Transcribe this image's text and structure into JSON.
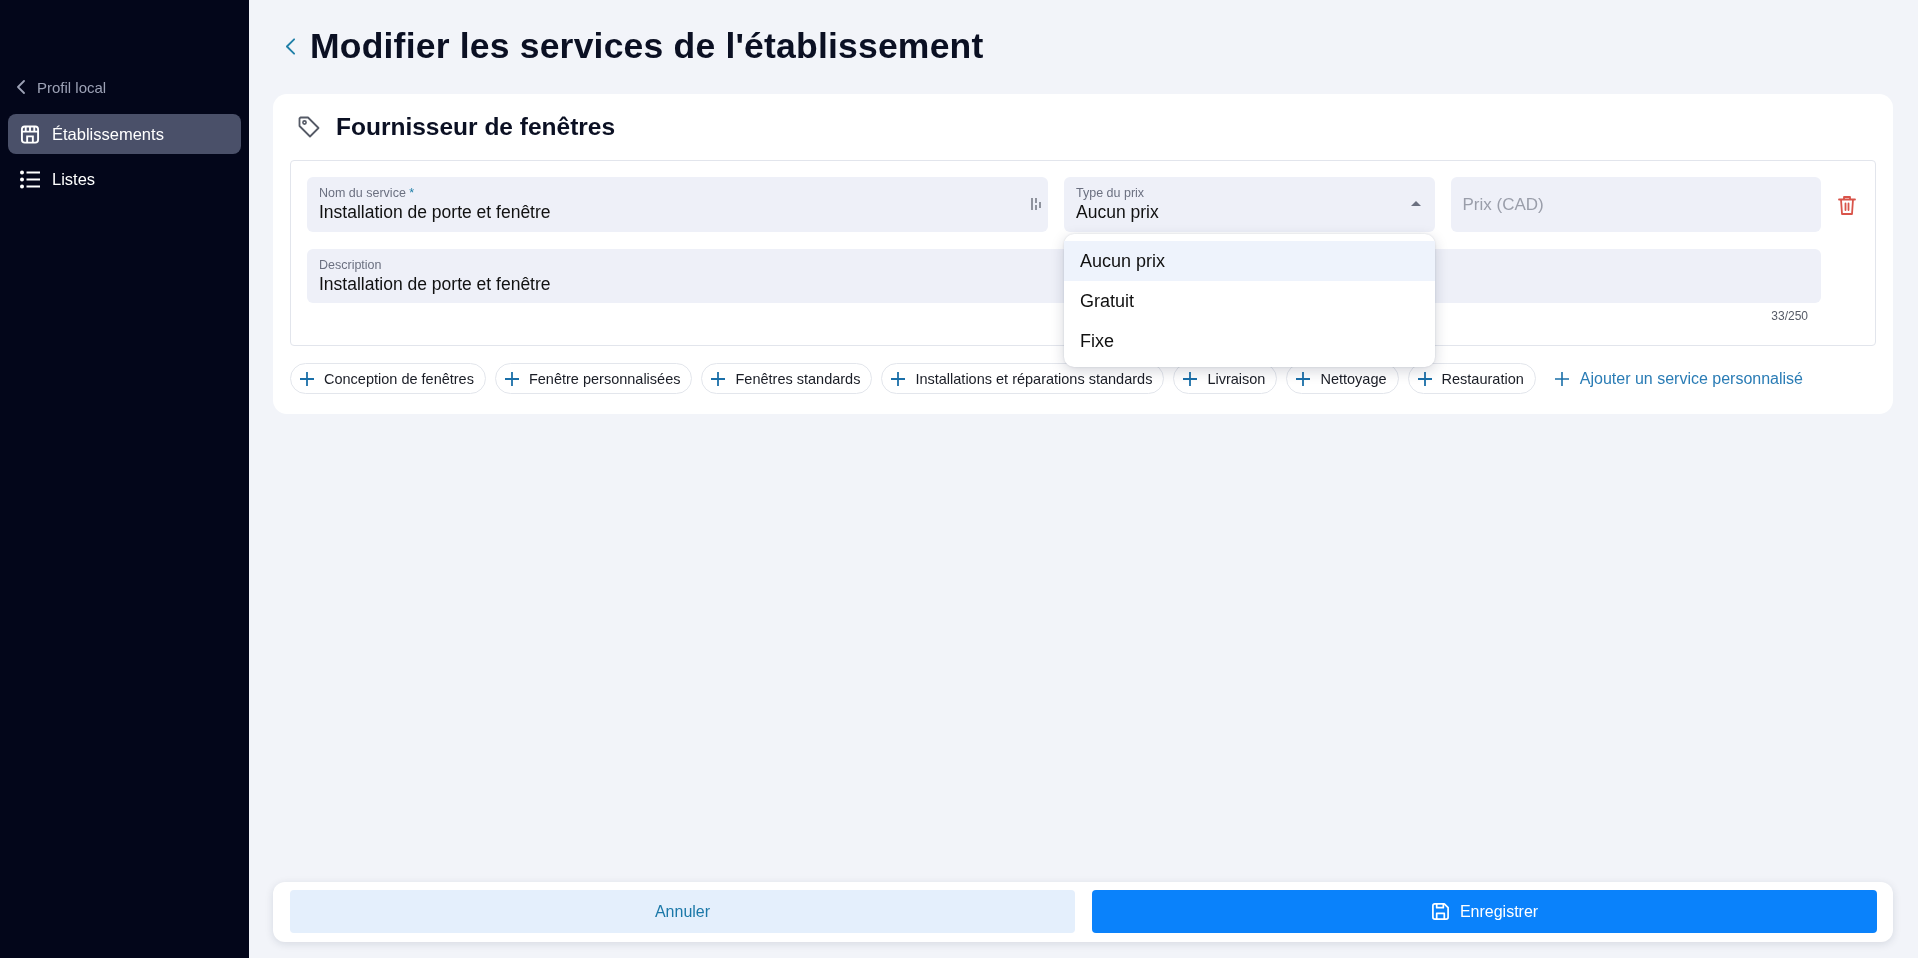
{
  "sidebar": {
    "back_link": {
      "label": "Profil local"
    },
    "items": [
      {
        "label": "Établissements",
        "selected": true
      },
      {
        "label": "Listes",
        "selected": false
      }
    ]
  },
  "page": {
    "title": "Modifier les services de l'établissement"
  },
  "card": {
    "title": "Fournisseur de fenêtres",
    "services": [
      {
        "name": {
          "label": "Nom du service",
          "required_mark": "*",
          "value": "Installation de porte et fenêtre"
        },
        "price_type": {
          "label": "Type du prix",
          "value": "Aucun prix",
          "expanded": true,
          "options": [
            {
              "label": "Aucun prix",
              "selected": true
            },
            {
              "label": "Gratuit",
              "selected": false
            },
            {
              "label": "Fixe",
              "selected": false
            }
          ]
        },
        "price": {
          "placeholder": "Prix (CAD)"
        },
        "description": {
          "label": "Description",
          "value": "Installation de porte et fenêtre",
          "counter": "33/250"
        }
      }
    ],
    "suggestions": [
      "Conception de fenêtres",
      "Fenêtre personnalisées",
      "Fenêtres standards",
      "Installations et réparations standards",
      "Livraison",
      "Nettoyage",
      "Restauration"
    ],
    "add_custom": {
      "label": "Ajouter un service personnalisé"
    }
  },
  "footer": {
    "cancel": {
      "label": "Annuler"
    },
    "save": {
      "label": "Enregistrer"
    }
  }
}
